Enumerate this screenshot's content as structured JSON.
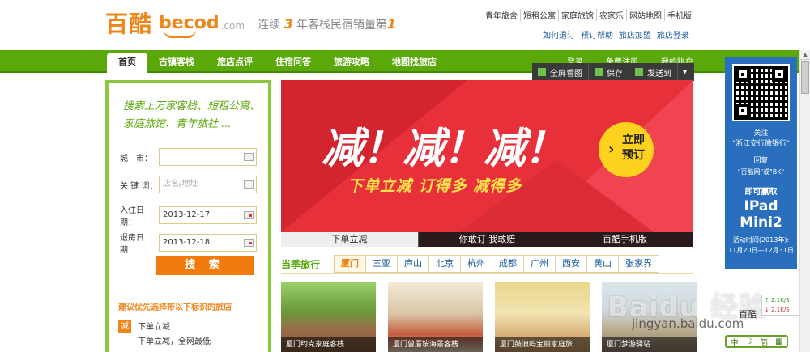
{
  "header": {
    "logo_cn": "百酷",
    "logo_en": "becod",
    "logo_com": ".com",
    "slogan_pre": "连续",
    "slogan_n1": "3",
    "slogan_mid": "年客栈民宿销量第",
    "slogan_n2": "1",
    "toplinks": [
      "青年旅舍",
      "短租公寓",
      "家庭旅馆",
      "农家乐",
      "网站地图",
      "手机版"
    ],
    "toplinks2": [
      "如何退订",
      "预订帮助",
      "旅店加盟",
      "旅店登录"
    ]
  },
  "nav": {
    "items": [
      "首页",
      "古镇客栈",
      "旅店点评",
      "住宿问答",
      "旅游攻略",
      "地图找旅店"
    ],
    "right": [
      "登录",
      "免费注册",
      "我的账户"
    ]
  },
  "share": {
    "fullscreen": "全屏看图",
    "save": "保存",
    "send": "发送到"
  },
  "search": {
    "title": "搜索上万家客栈、短租公寓、家庭旅馆、青年旅社 ...",
    "city_label": "城　市：",
    "city_value": "",
    "keyword_label": "关 键 词：",
    "keyword_placeholder": "店名/地址",
    "checkin_label": "入住日期：",
    "checkin_value": "2013-12-17",
    "checkout_label": "退房日期：",
    "checkout_value": "2013-12-18",
    "button": "搜 索"
  },
  "tip": {
    "title": "建议优先选择带以下标识的旅店",
    "icon": "减",
    "promo_title": "下单立减",
    "promo_sub": "下单立减，全网最低"
  },
  "banner": {
    "main": "减！减！减！",
    "sub": "下单立减  订得多  减得多",
    "cta_line1": "立即",
    "cta_line2": "预订",
    "tabs": [
      "下单立减",
      "你敢订 我敢赔",
      "百酷手机版"
    ]
  },
  "cities": {
    "label": "当季旅行",
    "items": [
      "厦门",
      "三亚",
      "庐山",
      "北京",
      "杭州",
      "成都",
      "广州",
      "西安",
      "黄山",
      "张家界"
    ]
  },
  "thumbs": [
    "厦门约克家庭客栈",
    "厦门曾厝垵海景客栈",
    "厦门鼓浪屿宝丽家庭旅",
    "厦门梦游驿站"
  ],
  "qr_ad": {
    "l1": "关注",
    "l2": "\"浙江交行微银行\"",
    "l3": "回复",
    "l4": "\"百酷网\"或\"BK\"",
    "l5": "即可赢取",
    "l6": "IPad Mini2",
    "l7": "活动时间(2013年):",
    "l8": "11月20日—12月31日"
  },
  "speed": {
    "up": "2.1K/S",
    "down": "2.1K/S",
    "label": "百酷"
  },
  "watermark": {
    "brand": "Baidu 经验",
    "url": "jingyan.baidu.com"
  },
  "ime": {
    "a": "中",
    "b": "简"
  }
}
